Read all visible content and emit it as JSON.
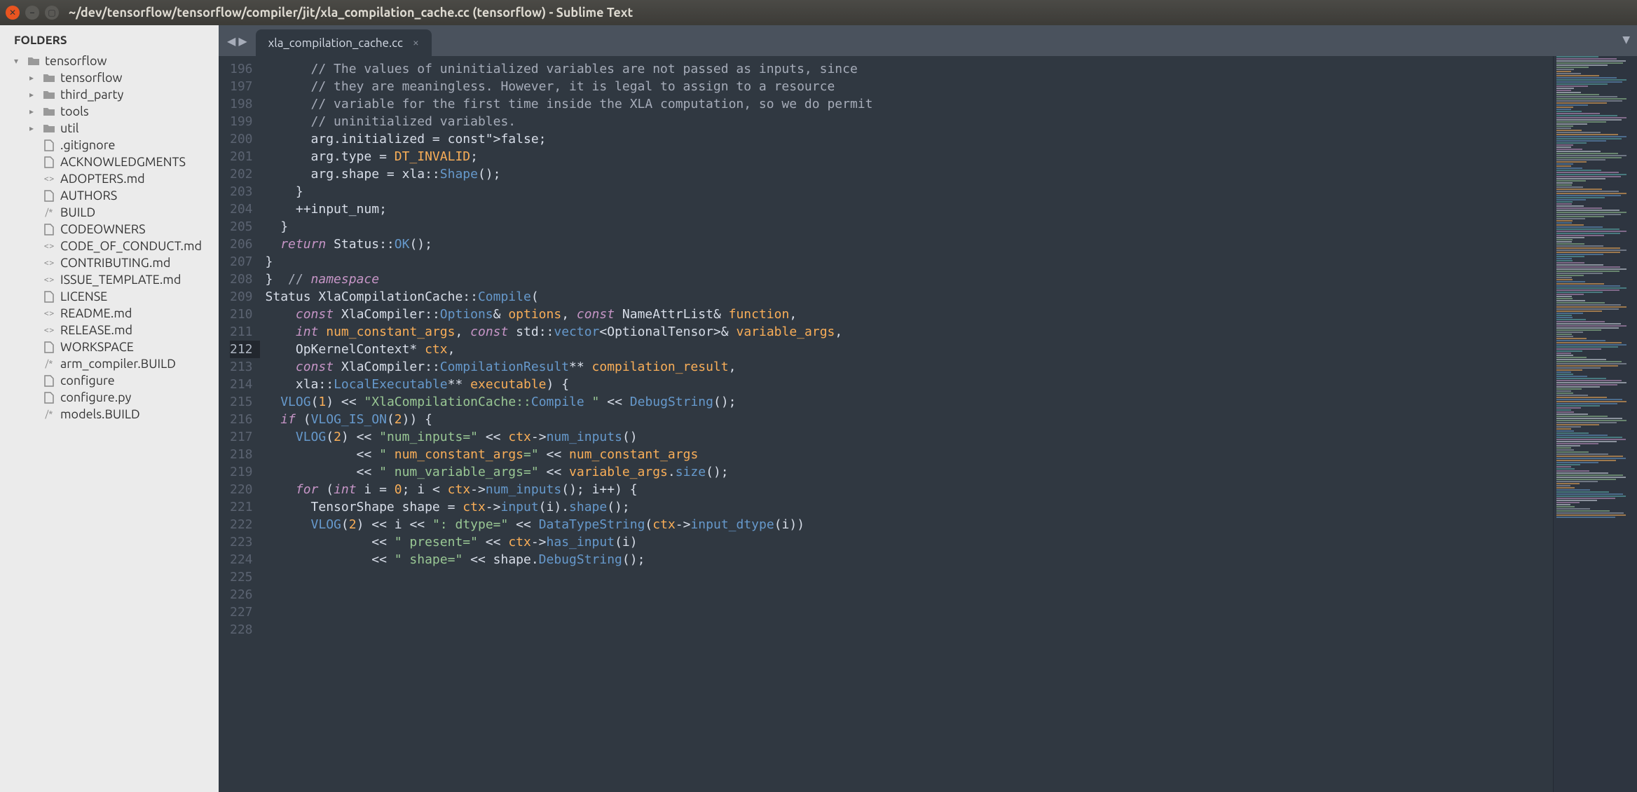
{
  "window": {
    "title": "~/dev/tensorflow/tensorflow/compiler/jit/xla_compilation_cache.cc (tensorflow) - Sublime Text"
  },
  "sidebar": {
    "header": "FOLDERS",
    "root": {
      "name": "tensorflow"
    },
    "folders": [
      {
        "name": "tensorflow"
      },
      {
        "name": "third_party"
      },
      {
        "name": "tools"
      },
      {
        "name": "util"
      }
    ],
    "files": [
      {
        "name": ".gitignore",
        "kind": "file"
      },
      {
        "name": "ACKNOWLEDGMENTS",
        "kind": "file"
      },
      {
        "name": "ADOPTERS.md",
        "kind": "md"
      },
      {
        "name": "AUTHORS",
        "kind": "file"
      },
      {
        "name": "BUILD",
        "kind": "build"
      },
      {
        "name": "CODEOWNERS",
        "kind": "file"
      },
      {
        "name": "CODE_OF_CONDUCT.md",
        "kind": "md"
      },
      {
        "name": "CONTRIBUTING.md",
        "kind": "md"
      },
      {
        "name": "ISSUE_TEMPLATE.md",
        "kind": "md"
      },
      {
        "name": "LICENSE",
        "kind": "file"
      },
      {
        "name": "README.md",
        "kind": "md"
      },
      {
        "name": "RELEASE.md",
        "kind": "md"
      },
      {
        "name": "WORKSPACE",
        "kind": "file"
      },
      {
        "name": "arm_compiler.BUILD",
        "kind": "build"
      },
      {
        "name": "configure",
        "kind": "file"
      },
      {
        "name": "configure.py",
        "kind": "file"
      },
      {
        "name": "models.BUILD",
        "kind": "build"
      }
    ]
  },
  "tabs": [
    {
      "label": "xla_compilation_cache.cc",
      "active": true
    }
  ],
  "editor": {
    "first_line": 196,
    "cursor_line": 212,
    "lines": {
      "196": "      // The values of uninitialized variables are not passed as inputs, since",
      "197": "      // they are meaningless. However, it is legal to assign to a resource",
      "198": "      // variable for the first time inside the XLA computation, so we do permit",
      "199": "      // uninitialized variables.",
      "200": "      arg.initialized = false;",
      "201": "      arg.type = DT_INVALID;",
      "202": "      arg.shape = xla::Shape();",
      "203": "    }",
      "204": "    ++input_num;",
      "205": "  }",
      "206": "",
      "207": "  return Status::OK();",
      "208": "}",
      "209": "",
      "210": "}  // namespace",
      "211": "",
      "212": "Status XlaCompilationCache::Compile(",
      "213": "    const XlaCompiler::Options& options, const NameAttrList& function,",
      "214": "    int num_constant_args, const std::vector<OptionalTensor>& variable_args,",
      "215": "    OpKernelContext* ctx,",
      "216": "    const XlaCompiler::CompilationResult** compilation_result,",
      "217": "    xla::LocalExecutable** executable) {",
      "218": "  VLOG(1) << \"XlaCompilationCache::Compile \" << DebugString();",
      "219": "",
      "220": "  if (VLOG_IS_ON(2)) {",
      "221": "    VLOG(2) << \"num_inputs=\" << ctx->num_inputs()",
      "222": "            << \" num_constant_args=\" << num_constant_args",
      "223": "            << \" num_variable_args=\" << variable_args.size();",
      "224": "    for (int i = 0; i < ctx->num_inputs(); i++) {",
      "225": "      TensorShape shape = ctx->input(i).shape();",
      "226": "      VLOG(2) << i << \": dtype=\" << DataTypeString(ctx->input_dtype(i))",
      "227": "              << \" present=\" << ctx->has_input(i)",
      "228": "              << \" shape=\" << shape.DebugString();"
    }
  }
}
